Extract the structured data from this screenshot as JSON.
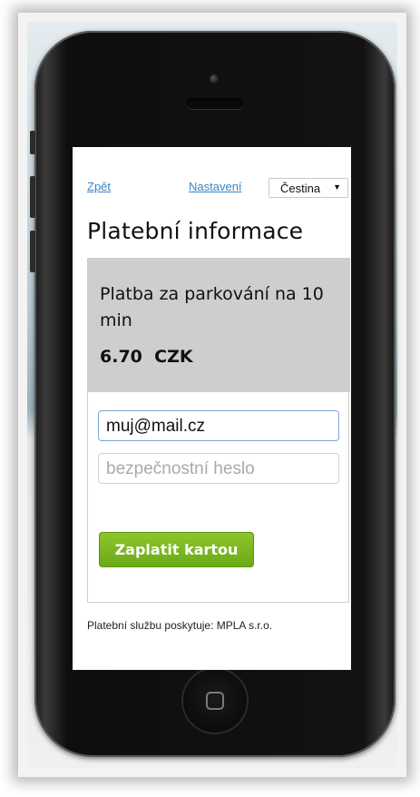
{
  "nav": {
    "back_label": "Zpět",
    "settings_label": "Nastavení",
    "language": "Čestina"
  },
  "page": {
    "title": "Platební informace"
  },
  "payment": {
    "description": "Platba za parkování na 10 min",
    "amount": "6.70",
    "currency": "CZK"
  },
  "form": {
    "email_value": "muj@mail.cz",
    "password_placeholder": "bezpečnostní heslo",
    "pay_button_label": "Zaplatit kartou"
  },
  "footer": {
    "provider_text": "Platební službu poskytuje: MPLA s.r.o."
  },
  "colors": {
    "link": "#3a84c8",
    "pay_button": "#7ab622",
    "info_box": "#cecece"
  }
}
